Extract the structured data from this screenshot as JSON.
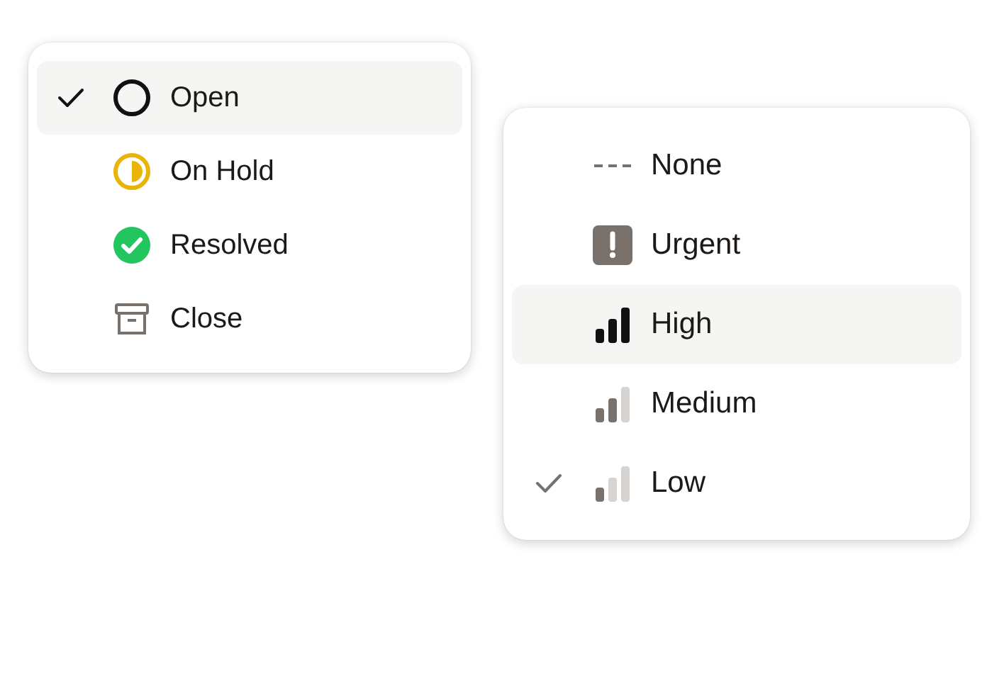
{
  "status_menu": {
    "items": [
      {
        "label": "Open",
        "kind": "circle",
        "selected": true,
        "highlighted": true
      },
      {
        "label": "On Hold",
        "kind": "half",
        "selected": false,
        "highlighted": false
      },
      {
        "label": "Resolved",
        "kind": "done",
        "selected": false,
        "highlighted": false
      },
      {
        "label": "Close",
        "kind": "archive",
        "selected": false,
        "highlighted": false
      }
    ]
  },
  "priority_menu": {
    "items": [
      {
        "label": "None",
        "kind": "dashes",
        "selected": false,
        "highlighted": false
      },
      {
        "label": "Urgent",
        "kind": "urgent",
        "selected": false,
        "highlighted": false
      },
      {
        "label": "High",
        "kind": "bars3",
        "selected": false,
        "highlighted": true
      },
      {
        "label": "Medium",
        "kind": "bars2",
        "selected": false,
        "highlighted": false
      },
      {
        "label": "Low",
        "kind": "bars1",
        "selected": true,
        "highlighted": false
      }
    ]
  }
}
